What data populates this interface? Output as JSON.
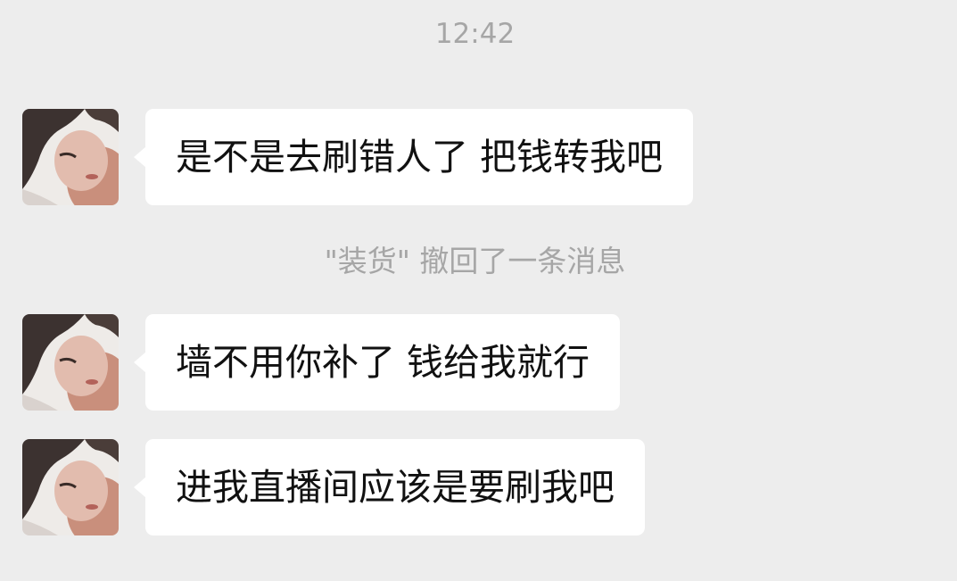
{
  "chat": {
    "timestamp": "12:42",
    "recall_notice": "\"装货\" 撤回了一条消息",
    "messages": [
      {
        "text": "是不是去刷错人了 把钱转我吧"
      },
      {
        "text": "墙不用你补了 钱给我就行"
      },
      {
        "text": "进我直播间应该是要刷我吧"
      }
    ]
  },
  "colors": {
    "background": "#ededed",
    "bubble": "#ffffff",
    "message_text": "#111111",
    "system_text": "#a6a6a6"
  }
}
